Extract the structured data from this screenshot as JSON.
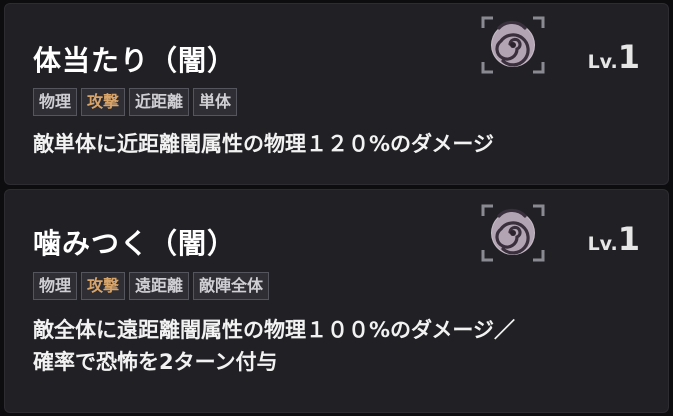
{
  "skills": [
    {
      "title": "体当たり（闇）",
      "level_prefix": "Lv.",
      "level": "1",
      "icon": "dark-swirl-icon",
      "tags": [
        "物理",
        "攻撃",
        "近距離",
        "単体"
      ],
      "description": "敵単体に近距離闇属性の物理１２０%のダメージ"
    },
    {
      "title": "噛みつく（闇）",
      "level_prefix": "Lv.",
      "level": "1",
      "icon": "dark-swirl-icon",
      "tags": [
        "物理",
        "攻撃",
        "遠距離",
        "敵陣全体"
      ],
      "description": "敵全体に遠距離闇属性の物理１００%のダメージ／\n確率で恐怖を2ターン付与"
    }
  ],
  "colors": {
    "card_bg": "#212125",
    "tag_attack": "#d7a46a",
    "tag_default": "#cfcfd4"
  }
}
